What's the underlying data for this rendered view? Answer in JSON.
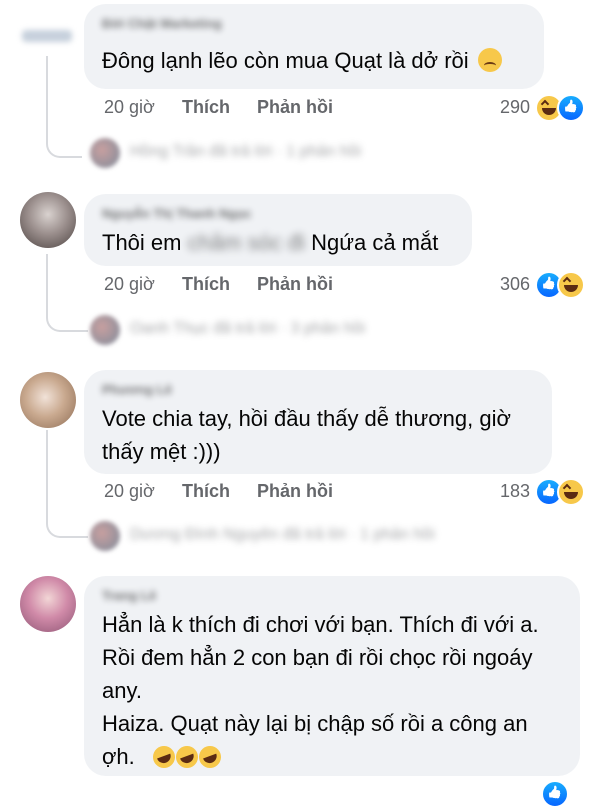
{
  "comments": [
    {
      "author": "Đời Chật Marketing",
      "text_lines": [
        "Đông lạnh lẽo còn mua Quạt là dở rồi"
      ],
      "emoji": "disappointed-face",
      "time": "20 giờ",
      "like_label": "Thích",
      "reply_label": "Phản hồi",
      "count": "290",
      "reactions": [
        "haha",
        "like"
      ],
      "reply_preview": "Hồng Trần đã trả lời · 1 phản hồi"
    },
    {
      "author": "Nguyễn Thị Thanh Ngọc",
      "text_prefix": "Thôi em",
      "text_hidden": "chăm sóc đi",
      "text_suffix": "Ngứa cả mắt",
      "time": "20 giờ",
      "like_label": "Thích",
      "reply_label": "Phản hồi",
      "count": "306",
      "reactions": [
        "like",
        "haha"
      ],
      "reply_preview": "Oanh Thục đã trả lời · 3 phản hồi"
    },
    {
      "author": "Phương Lê",
      "text_lines": [
        "Vote chia tay, hồi đầu thấy dễ thương, giờ",
        "thấy mệt :)))"
      ],
      "time": "20 giờ",
      "like_label": "Thích",
      "reply_label": "Phản hồi",
      "count": "183",
      "reactions": [
        "like",
        "haha"
      ],
      "reply_preview": "Dương Đình Nguyên đã trả lời · 1 phản hồi"
    },
    {
      "author": "Trang Lê",
      "text_lines": [
        "Hẳn là k thích đi chơi với bạn. Thích đi với a.",
        "Rồi đem hẳn 2 con bạn đi rồi chọc rồi ngoáy",
        "any.",
        "Haiza. Quạt này lại bị chập số rồi a công an",
        "ợh."
      ],
      "emoji": "rofl-x3"
    }
  ]
}
